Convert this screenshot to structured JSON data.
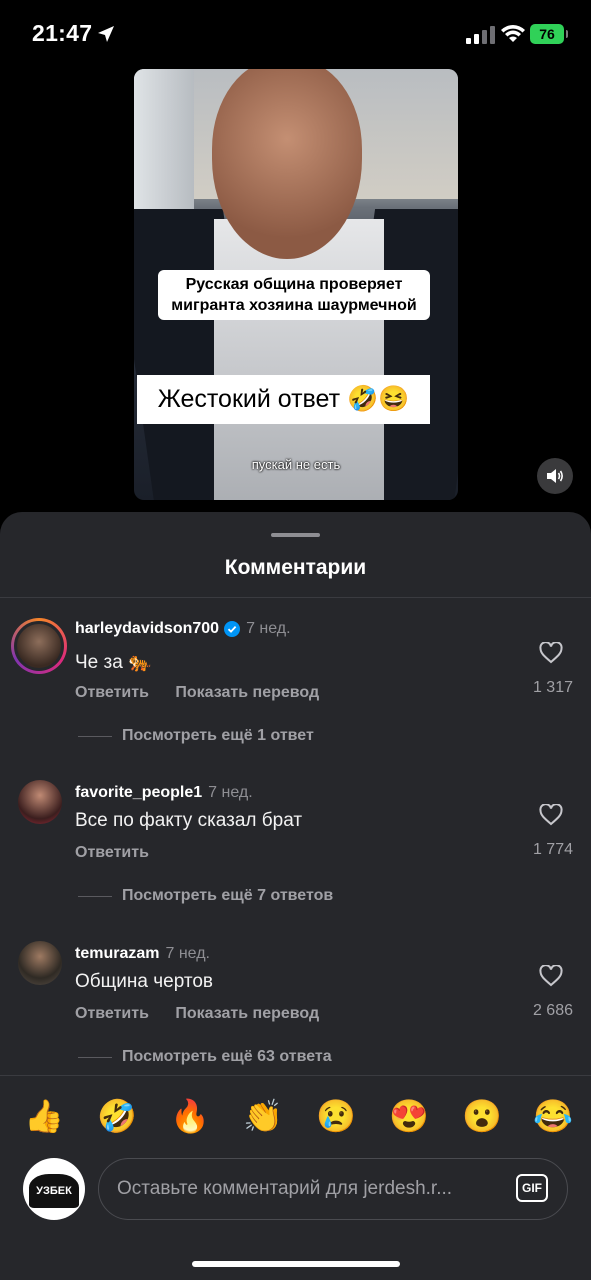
{
  "status_bar": {
    "time": "21:47",
    "battery": "76"
  },
  "video": {
    "caption_top": "Русская община проверяет мигранта хозяина шаурмечной",
    "caption_main": "Жестокий ответ 🤣😆",
    "subtitle": "пускай не есть",
    "sound_icon": "speaker-icon"
  },
  "sheet": {
    "title": "Комментарии",
    "comments": [
      {
        "username": "harleydavidson700",
        "verified": true,
        "ago": "7 нед.",
        "text": "Че за 🐅",
        "reply_label": "Ответить",
        "translate_label": "Показать перевод",
        "likes": "1 317",
        "replies": "Посмотреть ещё 1 ответ"
      },
      {
        "username": "favorite_people1",
        "verified": false,
        "ago": "7 нед.",
        "text": "Все по факту сказал брат",
        "reply_label": "Ответить",
        "translate_label": "",
        "likes": "1 774",
        "replies": "Посмотреть ещё 7 ответов"
      },
      {
        "username": "temurazam",
        "verified": false,
        "ago": "7 нед.",
        "text": "Община чертов",
        "reply_label": "Ответить",
        "translate_label": "Показать перевод",
        "likes": "2 686",
        "replies": "Посмотреть ещё 63 ответа"
      }
    ]
  },
  "emoji_bar": [
    "👍",
    "🤣",
    "🔥",
    "👏",
    "😢",
    "😍",
    "😮",
    "😂"
  ],
  "composer": {
    "avatar_text": "УЗБЕК",
    "placeholder": "Оставьте комментарий для jerdesh.r...",
    "gif_label": "GIF"
  },
  "colors": {
    "accent_verified": "#0095f6",
    "sheet_bg": "#26272b",
    "battery": "#30d158"
  }
}
